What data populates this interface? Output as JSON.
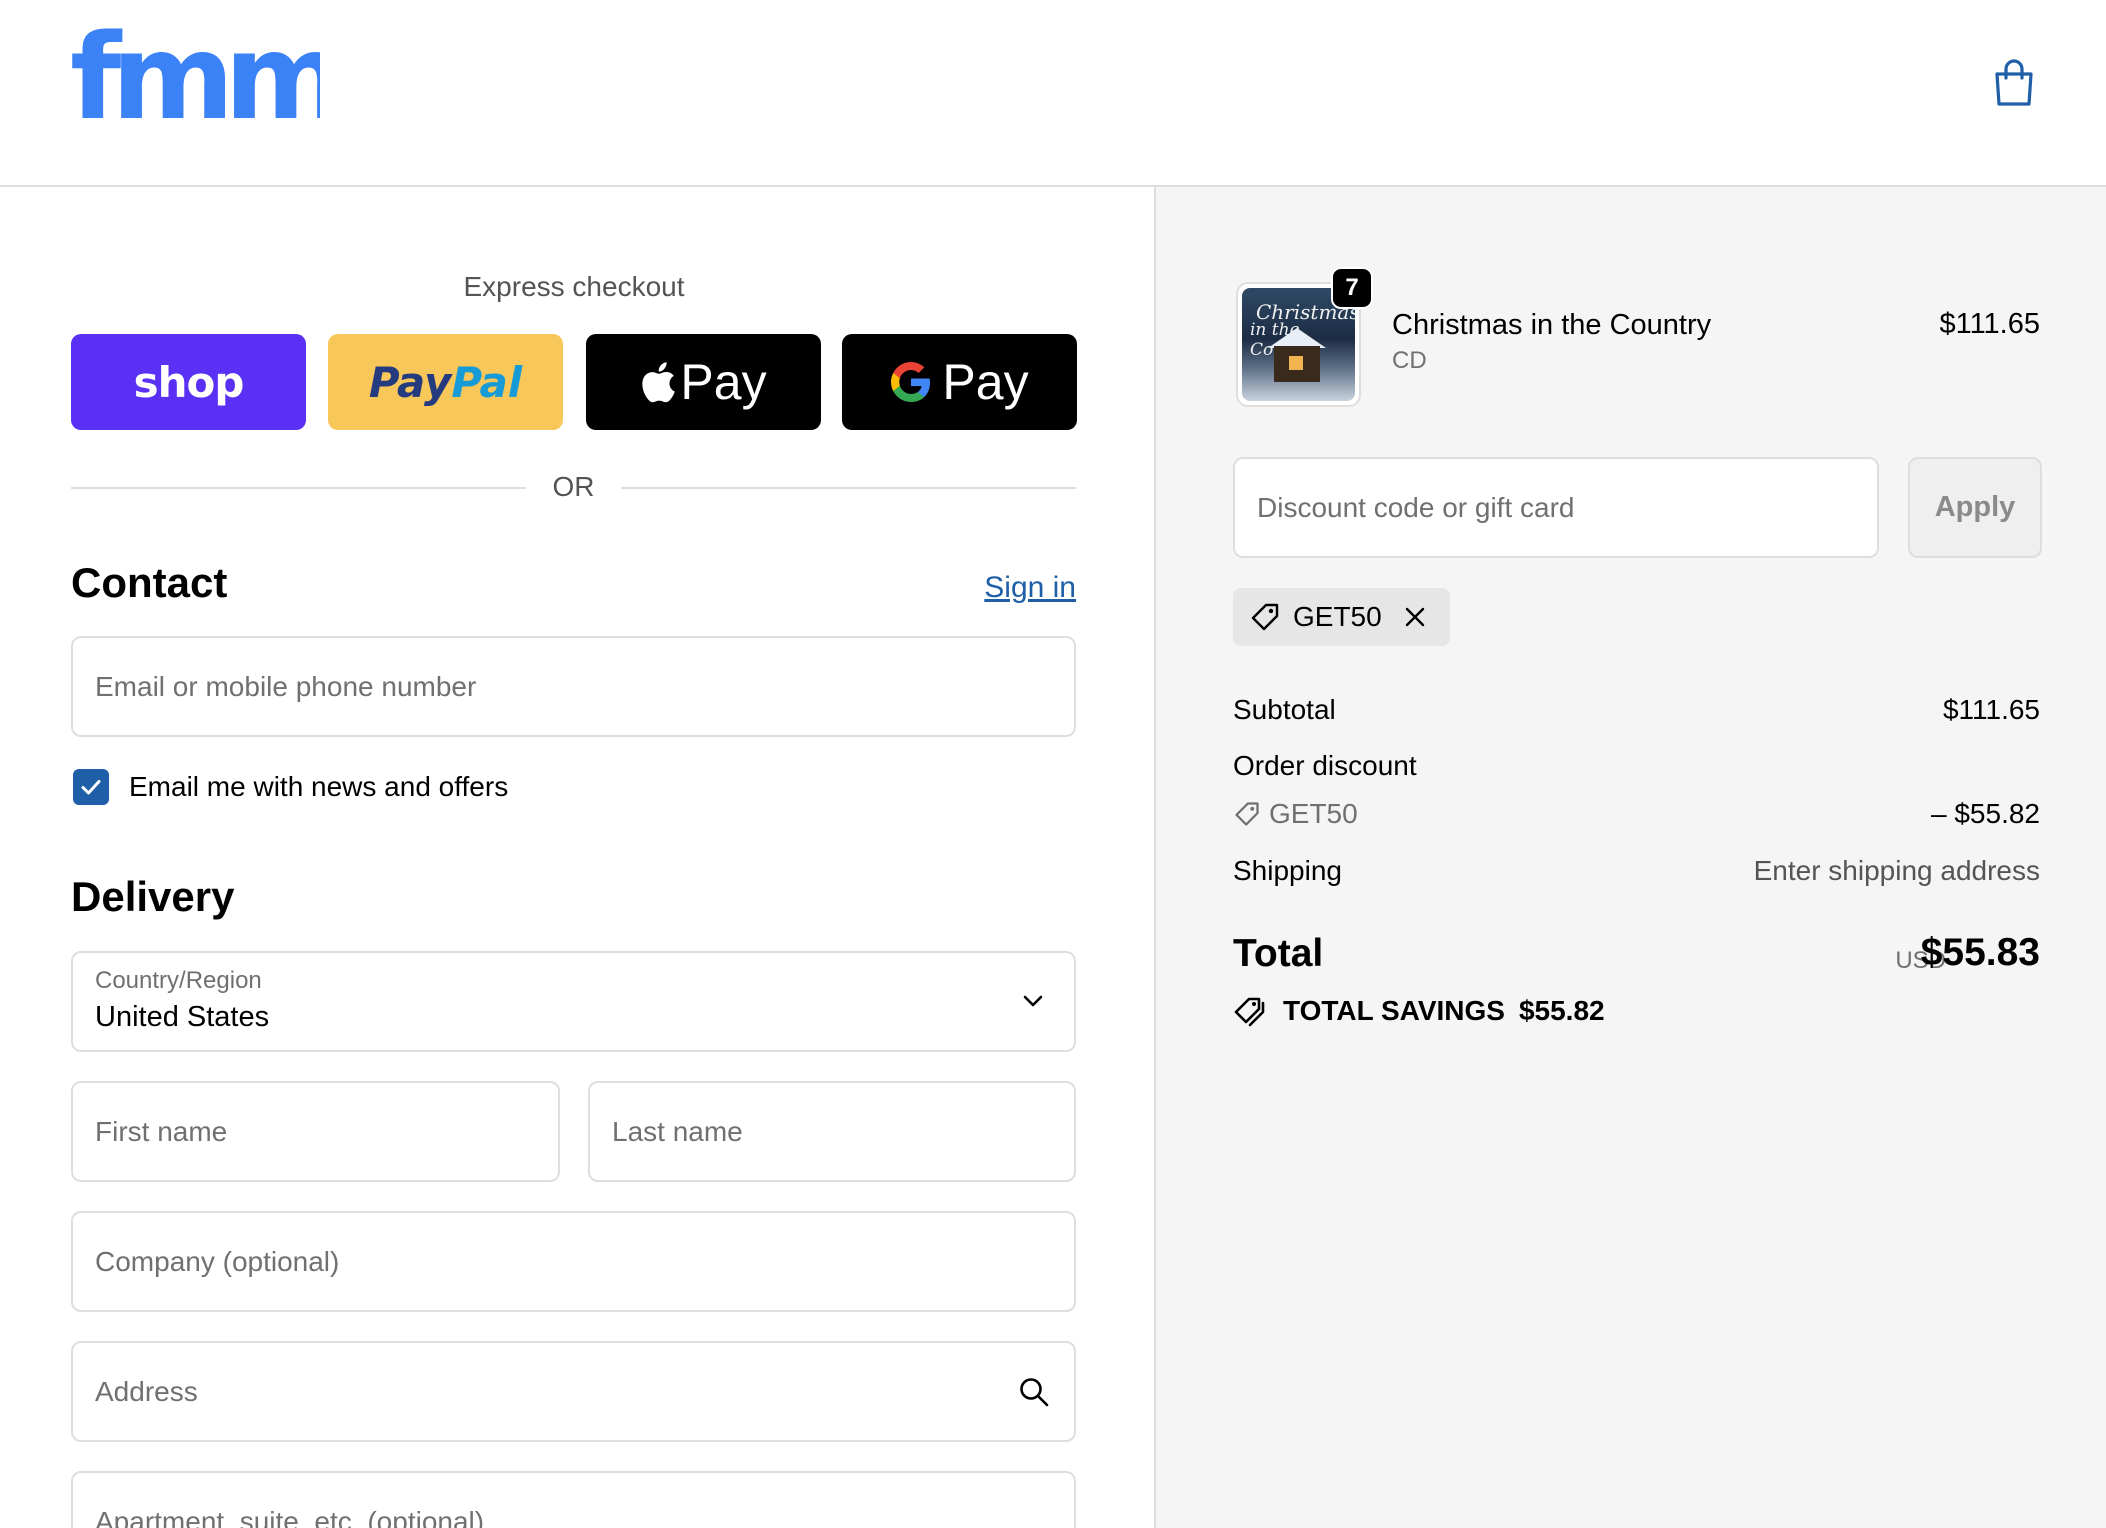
{
  "header": {
    "logo_text": "fmm",
    "brand_color": "#3b82f6"
  },
  "express": {
    "title": "Express checkout",
    "shop_label": "shop",
    "paypal_label_1": "Pay",
    "paypal_label_2": "Pal",
    "apple_pay_label": "Pay",
    "google_pay_label": "Pay",
    "or_text": "OR"
  },
  "contact": {
    "title": "Contact",
    "sign_in": "Sign in",
    "email_placeholder": "Email or mobile phone number",
    "newsletter_label": "Email me with news and offers",
    "newsletter_checked": true
  },
  "delivery": {
    "title": "Delivery",
    "country_label": "Country/Region",
    "country_value": "United States",
    "first_name_placeholder": "First name",
    "last_name_placeholder": "Last name",
    "company_placeholder": "Company (optional)",
    "address_placeholder": "Address",
    "apartment_placeholder": "Apartment, suite, etc. (optional)"
  },
  "order": {
    "item": {
      "cover_line_1": "Christmas",
      "cover_line_2": "in the Country",
      "name": "Christmas in the Country",
      "variant": "CD",
      "quantity": "7",
      "price": "$111.65"
    },
    "discount_placeholder": "Discount code or gift card",
    "apply_label": "Apply",
    "applied_code": "GET50",
    "subtotal_label": "Subtotal",
    "subtotal_value": "$111.65",
    "order_discount_label": "Order discount",
    "order_discount_code": "GET50",
    "order_discount_value": "– $55.82",
    "shipping_label": "Shipping",
    "shipping_value": "Enter shipping address",
    "total_label": "Total",
    "total_currency": "USD",
    "total_value": "$55.83",
    "savings_label": "TOTAL SAVINGS",
    "savings_value": "$55.82"
  },
  "colors": {
    "accent": "#1f5fa8",
    "shop_purple": "#5a31f4",
    "paypal_yellow": "#f7c75a"
  }
}
